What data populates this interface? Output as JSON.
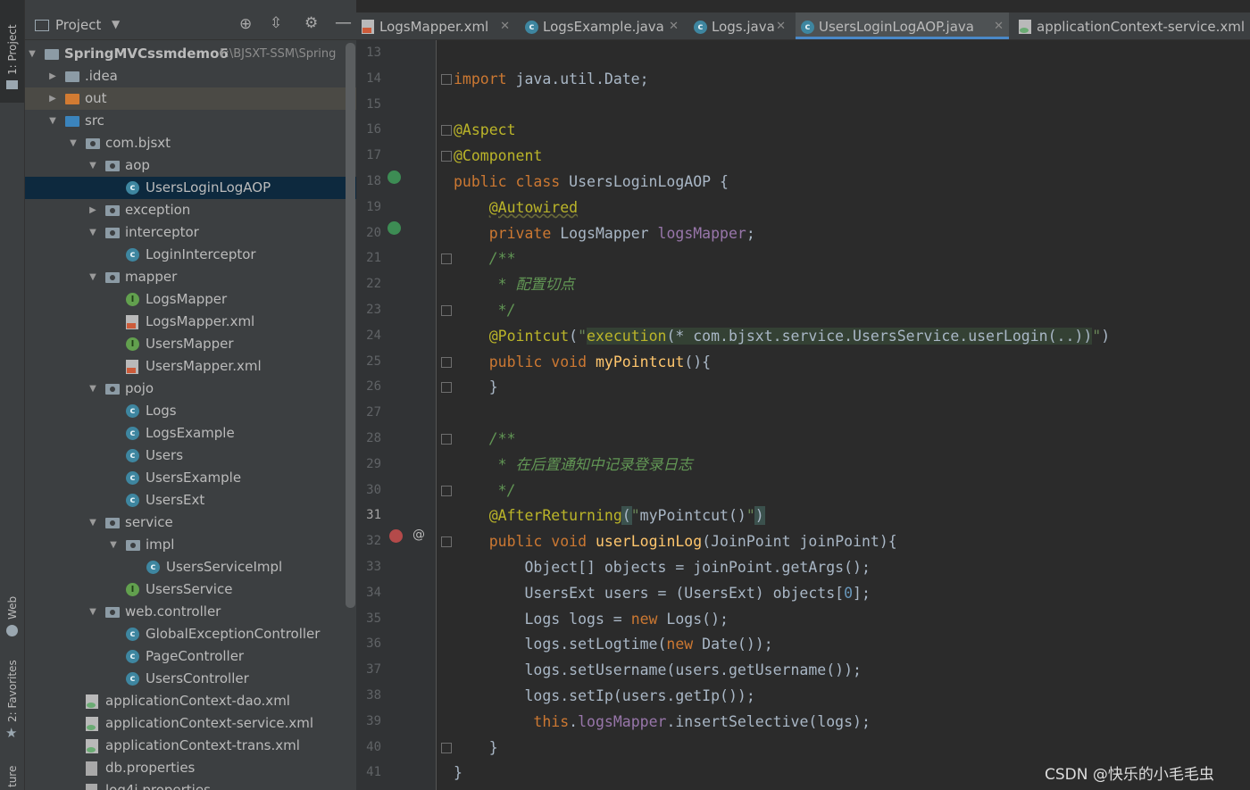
{
  "sidebar_tabs": {
    "project": "1: Project",
    "web": "Web",
    "favorites": "2: Favorites",
    "structure": "ture"
  },
  "project_panel": {
    "title": "Project",
    "tree": [
      {
        "label": "SpringMVCssmdemo6",
        "path": "F:\\BJSXT-SSM\\Spring",
        "type": "module",
        "arrow": "down"
      },
      {
        "label": ".idea",
        "type": "folder",
        "arrow": "right"
      },
      {
        "label": "out",
        "type": "folder-orange",
        "arrow": "right"
      },
      {
        "label": "src",
        "type": "folder-blue",
        "arrow": "down"
      },
      {
        "label": "com.bjsxt",
        "type": "package",
        "arrow": "down"
      },
      {
        "label": "aop",
        "type": "package",
        "arrow": "down"
      },
      {
        "label": "UsersLoginLogAOP",
        "type": "class",
        "arrow": ""
      },
      {
        "label": "exception",
        "type": "package",
        "arrow": "right"
      },
      {
        "label": "interceptor",
        "type": "package",
        "arrow": "down"
      },
      {
        "label": "LoginInterceptor",
        "type": "class",
        "arrow": ""
      },
      {
        "label": "mapper",
        "type": "package",
        "arrow": "down"
      },
      {
        "label": "LogsMapper",
        "type": "interface",
        "arrow": ""
      },
      {
        "label": "LogsMapper.xml",
        "type": "xml",
        "arrow": ""
      },
      {
        "label": "UsersMapper",
        "type": "interface",
        "arrow": ""
      },
      {
        "label": "UsersMapper.xml",
        "type": "xml",
        "arrow": ""
      },
      {
        "label": "pojo",
        "type": "package",
        "arrow": "down"
      },
      {
        "label": "Logs",
        "type": "class",
        "arrow": ""
      },
      {
        "label": "LogsExample",
        "type": "class",
        "arrow": ""
      },
      {
        "label": "Users",
        "type": "class",
        "arrow": ""
      },
      {
        "label": "UsersExample",
        "type": "class",
        "arrow": ""
      },
      {
        "label": "UsersExt",
        "type": "class",
        "arrow": ""
      },
      {
        "label": "service",
        "type": "package",
        "arrow": "down"
      },
      {
        "label": "impl",
        "type": "package",
        "arrow": "down"
      },
      {
        "label": "UsersServiceImpl",
        "type": "class",
        "arrow": ""
      },
      {
        "label": "UsersService",
        "type": "interface",
        "arrow": ""
      },
      {
        "label": "web.controller",
        "type": "package",
        "arrow": "down"
      },
      {
        "label": "GlobalExceptionController",
        "type": "class",
        "arrow": ""
      },
      {
        "label": "PageController",
        "type": "class",
        "arrow": ""
      },
      {
        "label": "UsersController",
        "type": "class",
        "arrow": ""
      },
      {
        "label": "applicationContext-dao.xml",
        "type": "spring-xml",
        "arrow": ""
      },
      {
        "label": "applicationContext-service.xml",
        "type": "spring-xml",
        "arrow": ""
      },
      {
        "label": "applicationContext-trans.xml",
        "type": "spring-xml",
        "arrow": ""
      },
      {
        "label": "db.properties",
        "type": "properties",
        "arrow": ""
      },
      {
        "label": "log4j.properties",
        "type": "properties",
        "arrow": ""
      }
    ]
  },
  "tabs": [
    {
      "label": "LogsMapper.xml",
      "type": "xml"
    },
    {
      "label": "LogsExample.java",
      "type": "class"
    },
    {
      "label": "Logs.java",
      "type": "class"
    },
    {
      "label": "UsersLoginLogAOP.java",
      "type": "class",
      "active": true
    },
    {
      "label": "applicationContext-service.xml",
      "type": "spring-xml"
    }
  ],
  "editor": {
    "current_line": 31,
    "lines": [
      {
        "n": "13",
        "html": ""
      },
      {
        "n": "14",
        "html": "<span class='kw'>import</span> java.util.Date;"
      },
      {
        "n": "15",
        "html": ""
      },
      {
        "n": "16",
        "html": "<span class='ann'>@Aspect</span>"
      },
      {
        "n": "17",
        "html": "<span class='ann'>@Component</span>"
      },
      {
        "n": "18",
        "html": "<span class='kw'>public class</span> UsersLoginLogAOP {"
      },
      {
        "n": "19",
        "html": "    <span class='ann' style='text-decoration:underline wavy #6a6a3a'>@Autowired</span>"
      },
      {
        "n": "20",
        "html": "    <span class='kw'>private</span> LogsMapper <span class='fld'>logsMapper</span>;"
      },
      {
        "n": "21",
        "html": "    <span class='cmt'>/**</span>"
      },
      {
        "n": "22",
        "html": "<span class='cmt'>     * 配置切点</span>"
      },
      {
        "n": "23",
        "html": "<span class='cmt'>     */</span>"
      },
      {
        "n": "24",
        "html": "    <span class='ann'>@Pointcut</span>(<span class='str'>\"</span><span class='pc'><span class='mth' style='color:#bbb529'>execution</span>(* com.bjsxt.service.UsersService.userLogin(..))</span><span class='str'>\"</span>)"
      },
      {
        "n": "25",
        "html": "    <span class='kw'>public void</span> <span class='mth'>myPointcut</span>(){"
      },
      {
        "n": "26",
        "html": "    }"
      },
      {
        "n": "27",
        "html": ""
      },
      {
        "n": "28",
        "html": "    <span class='cmt'>/**</span>"
      },
      {
        "n": "29",
        "html": "<span class='cmt'>     * 在后置通知中记录登录日志</span>"
      },
      {
        "n": "30",
        "html": "<span class='cmt'>     */</span>"
      },
      {
        "n": "31",
        "html": "    <span class='ann'>@AfterReturning</span><span class='bracehl'>(</span><span class='str'>\"</span>myPointcut()<span class='str'>\"</span><span class='bracehl'>)</span>"
      },
      {
        "n": "32",
        "html": "    <span class='kw'>public void</span> <span class='mth'>userLoginLog</span>(JoinPoint joinPoint){"
      },
      {
        "n": "33",
        "html": "        Object[] objects = joinPoint.getArgs();"
      },
      {
        "n": "34",
        "html": "        UsersExt users = (UsersExt) objects[<span class='num'>0</span>];"
      },
      {
        "n": "35",
        "html": "        Logs logs = <span class='kw'>new</span> Logs();"
      },
      {
        "n": "36",
        "html": "        logs.setLogtime(<span class='kw'>new</span> Date());"
      },
      {
        "n": "37",
        "html": "        logs.setUsername(users.getUsername());"
      },
      {
        "n": "38",
        "html": "        logs.setIp(users.getIp());"
      },
      {
        "n": "39",
        "html": "         <span class='kw'>this</span>.<span class='fld'>logsMapper</span>.insertSelective(logs);"
      },
      {
        "n": "40",
        "html": "    }"
      },
      {
        "n": "41",
        "html": "}"
      }
    ]
  },
  "watermark": "CSDN @快乐的小毛毛虫"
}
